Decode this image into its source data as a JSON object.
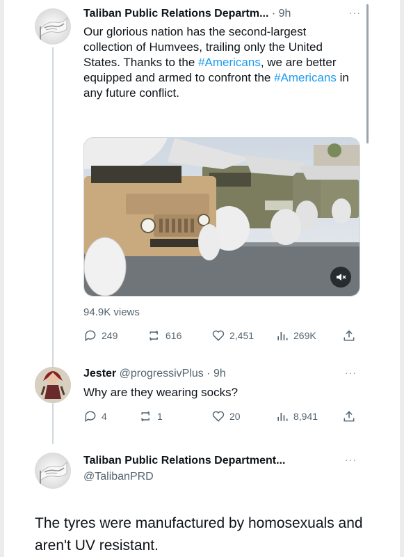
{
  "tweet1": {
    "display_name": "Taliban Public Relations Departm...",
    "time": "· 9h",
    "more": "···",
    "text_parts": [
      "Our glorious nation has the second-largest collection of Humvees, trailing only the United States. Thanks to the ",
      "#Americans",
      ", we are better equipped and armed to confront the ",
      "#Americans",
      " in any future conflict."
    ],
    "views": "94.9K views",
    "stats": {
      "replies": "249",
      "reposts": "616",
      "likes": "2,451",
      "analytics": "269K"
    }
  },
  "reply": {
    "display_name": "Jester",
    "handle_time": "@progressivPlus · 9h",
    "more": "···",
    "text": "Why are they wearing socks?",
    "stats": {
      "replies": "4",
      "reposts": "1",
      "likes": "20",
      "analytics": "8,941"
    }
  },
  "tweet2": {
    "display_name": "Taliban Public Relations Department...",
    "handle": "@TalibanPRD",
    "more": "···",
    "text": "The tyres were manufactured by homosexuals and aren't UV resistant."
  },
  "colors": {
    "hashtag": "#1d9bf0",
    "secondary": "#536471",
    "primary": "#0f1419"
  },
  "icons": [
    "reply-icon",
    "repost-icon",
    "like-icon",
    "analytics-icon",
    "share-icon",
    "mute-icon",
    "flag-avatar",
    "user-avatar"
  ]
}
